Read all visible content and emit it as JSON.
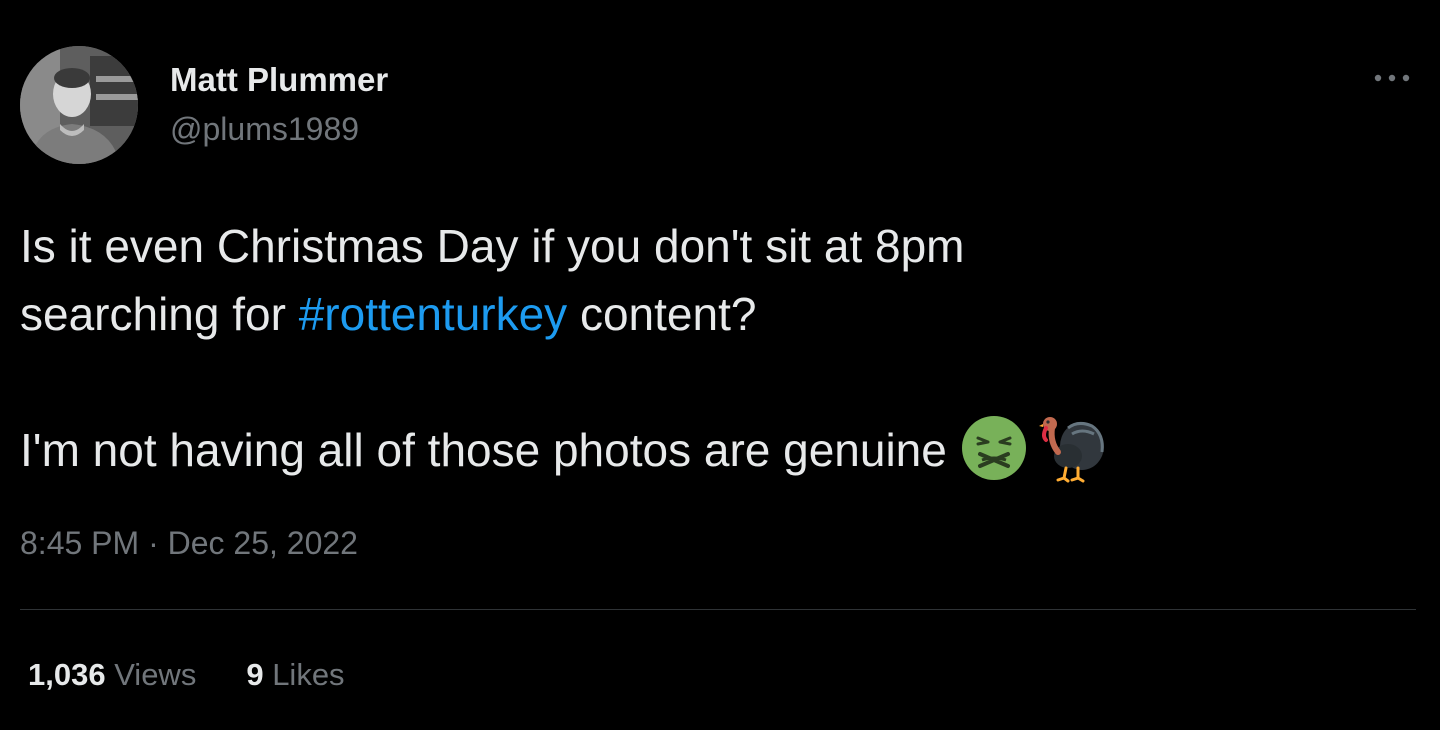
{
  "tweet": {
    "author": {
      "display_name": "Matt Plummer",
      "handle": "@plums1989"
    },
    "more_icon": "more-horizontal-icon",
    "text": {
      "line1": "Is it even Christmas Day if you don't sit at 8pm",
      "line2_prefix": "searching for ",
      "hashtag": "#rottenturkey",
      "line2_suffix": " content?",
      "line3": "I'm not having all of those photos are genuine ",
      "emojis": [
        "nauseated-face-emoji",
        "turkey-emoji"
      ]
    },
    "time": "8:45 PM",
    "separator": " · ",
    "date": "Dec 25, 2022",
    "stats": {
      "views_count": "1,036",
      "views_label": " Views",
      "likes_count": "9",
      "likes_label": " Likes"
    },
    "colors": {
      "background": "#000000",
      "text": "#e7e9ea",
      "secondary": "#71767b",
      "link": "#1d9bf0",
      "divider": "#2f3336"
    }
  }
}
